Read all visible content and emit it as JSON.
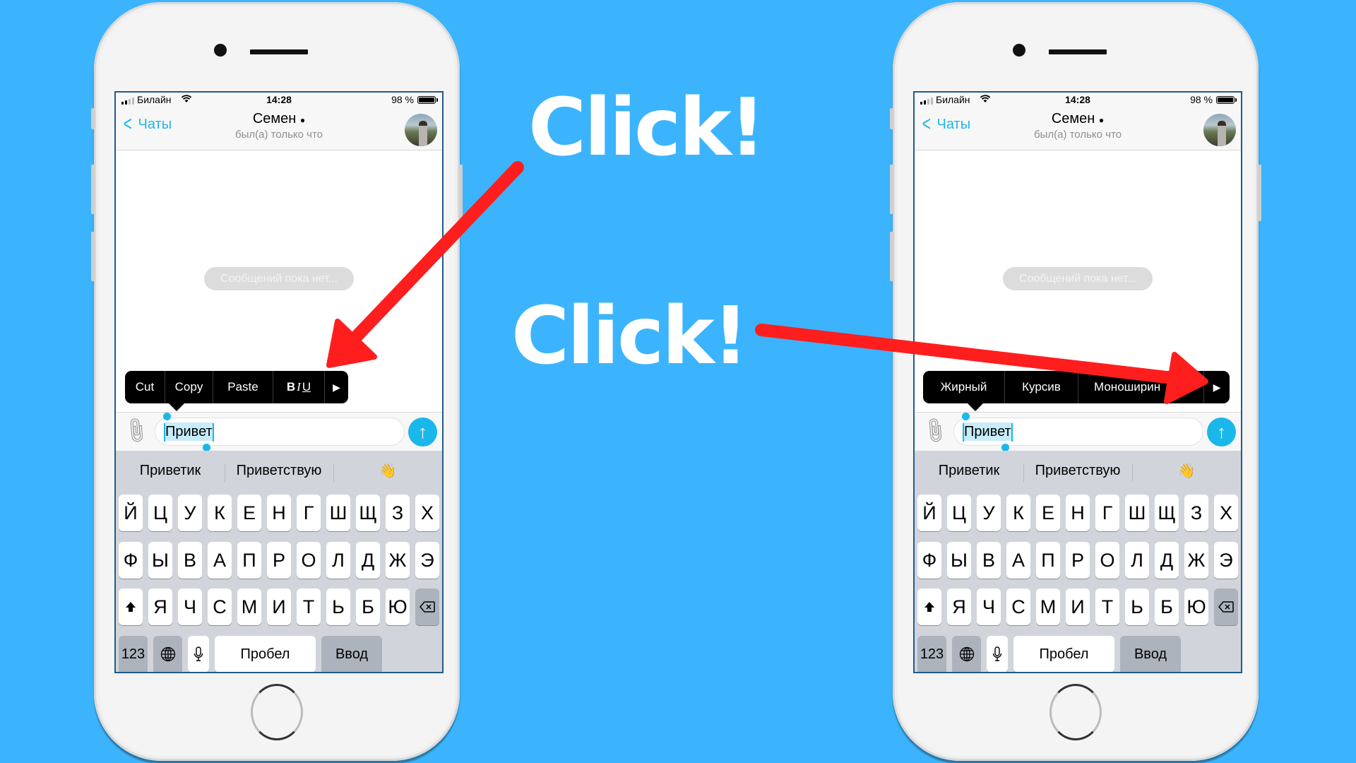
{
  "annotations": {
    "click_1": "Click!",
    "click_2": "Click!",
    "arrow_color": "#ff1e1e",
    "background_color": "#3bb4fd"
  },
  "phones": [
    {
      "status_bar": {
        "carrier": "Билайн",
        "time": "14:28",
        "battery": "98 %"
      },
      "header": {
        "back_label": "Чаты",
        "contact_name": "Семен",
        "contact_badge": "",
        "status": "был(а) только что"
      },
      "chat": {
        "empty_text": "Сообщений пока нет..."
      },
      "context_menu": {
        "items": [
          "Cut",
          "Copy",
          "Paste"
        ],
        "format_label_b": "B",
        "format_label_i": "I",
        "format_label_u": "U",
        "more": "▶"
      },
      "input": {
        "value": "Привет"
      },
      "keyboard": {
        "suggestions": [
          "Приветик",
          "Приветствую",
          "👋"
        ],
        "row1": [
          "Й",
          "Ц",
          "У",
          "К",
          "Е",
          "Н",
          "Г",
          "Ш",
          "Щ",
          "З",
          "Х"
        ],
        "row2": [
          "Ф",
          "Ы",
          "В",
          "А",
          "П",
          "Р",
          "О",
          "Л",
          "Д",
          "Ж",
          "Э"
        ],
        "row3": [
          "Я",
          "Ч",
          "С",
          "М",
          "И",
          "Т",
          "Ь",
          "Б",
          "Ю"
        ],
        "numbers_label": "123",
        "space_label": "Пробел",
        "return_label": "Ввод"
      }
    },
    {
      "status_bar": {
        "carrier": "Билайн",
        "time": "14:28",
        "battery": "98 %"
      },
      "header": {
        "back_label": "Чаты",
        "contact_name": "Семен",
        "contact_badge": "",
        "status": "был(а) только что"
      },
      "chat": {
        "empty_text": "Сообщений пока нет..."
      },
      "context_menu": {
        "items": [
          "Жирный",
          "Курсив",
          "Моноширин"
        ],
        "more": "▶"
      },
      "input": {
        "value": "Привет"
      },
      "keyboard": {
        "suggestions": [
          "Приветик",
          "Приветствую",
          "👋"
        ],
        "row1": [
          "Й",
          "Ц",
          "У",
          "К",
          "Е",
          "Н",
          "Г",
          "Ш",
          "Щ",
          "З",
          "Х"
        ],
        "row2": [
          "Ф",
          "Ы",
          "В",
          "А",
          "П",
          "Р",
          "О",
          "Л",
          "Д",
          "Ж",
          "Э"
        ],
        "row3": [
          "Я",
          "Ч",
          "С",
          "М",
          "И",
          "Т",
          "Ь",
          "Б",
          "Ю"
        ],
        "numbers_label": "123",
        "space_label": "Пробел",
        "return_label": "Ввод"
      }
    }
  ]
}
